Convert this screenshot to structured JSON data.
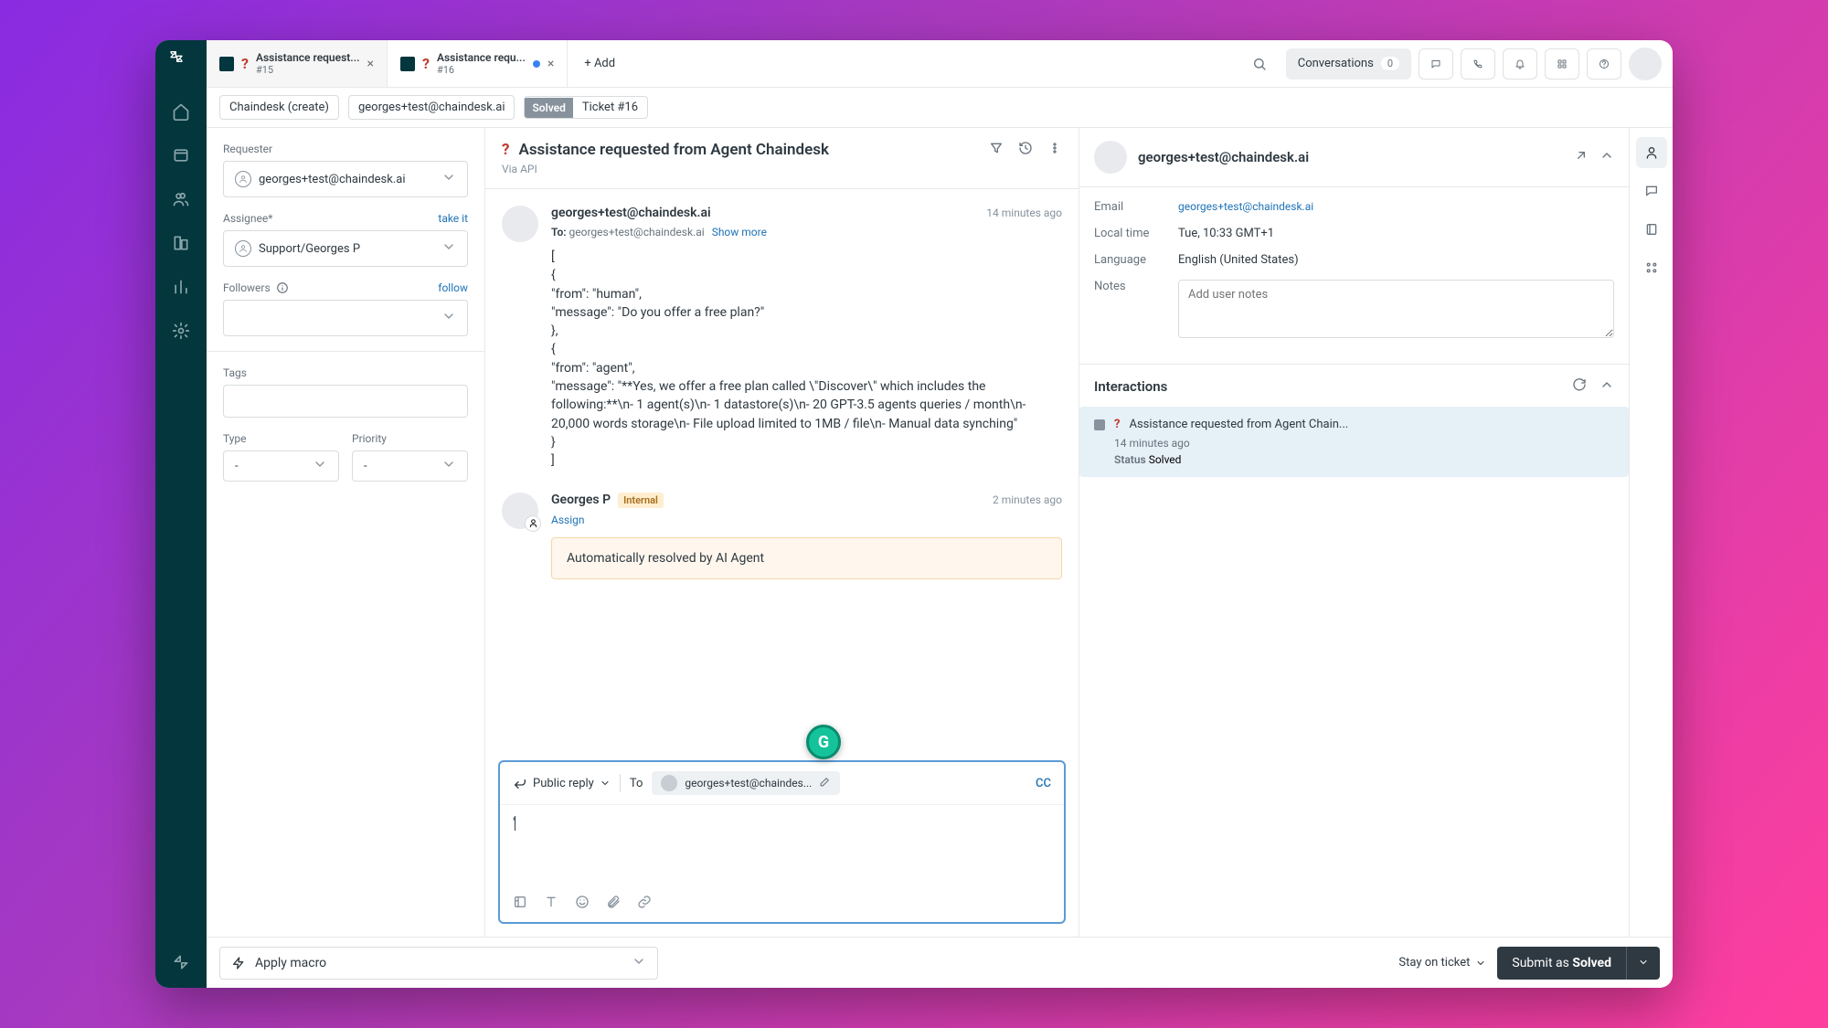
{
  "tabs": [
    {
      "title": "Assistance request...",
      "num": "#15"
    },
    {
      "title": "Assistance requ...",
      "num": "#16"
    }
  ],
  "addTab": "Add",
  "conversations": {
    "label": "Conversations",
    "count": "0"
  },
  "crumbs": {
    "org": "Chaindesk (create)",
    "email": "georges+test@chaindesk.ai",
    "status": "Solved",
    "ticket": "Ticket #16"
  },
  "left": {
    "requester": {
      "label": "Requester",
      "value": "georges+test@chaindesk.ai"
    },
    "assignee": {
      "label": "Assignee*",
      "link": "take it",
      "value": "Support/Georges P"
    },
    "followers": {
      "label": "Followers",
      "link": "follow"
    },
    "tags": {
      "label": "Tags"
    },
    "type": {
      "label": "Type",
      "value": "-"
    },
    "priority": {
      "label": "Priority",
      "value": "-"
    }
  },
  "center": {
    "title": "Assistance requested from Agent Chaindesk",
    "via": "Via API",
    "msg1": {
      "from": "georges+test@chaindesk.ai",
      "time": "14 minutes ago",
      "to": "To:",
      "toval": "georges+test@chaindesk.ai",
      "showmore": "Show more",
      "body": "[\n{\n\"from\": \"human\",\n\"message\": \"Do you offer a free plan?\"\n},\n{\n\"from\": \"agent\",\n\"message\": \"**Yes, we offer a free plan called \\\"Discover\\\" which includes the following:**\\n- 1 agent(s)\\n- 1 datastore(s)\\n- 20 GPT-3.5 agents queries / month\\n- 20,000 words storage\\n- File upload limited to 1MB / file\\n- Manual data synching\"\n}\n]"
    },
    "msg2": {
      "from": "Georges P",
      "badge": "Internal",
      "time": "2 minutes ago",
      "assign": "Assign",
      "note": "Automatically resolved by AI Agent"
    },
    "composer": {
      "replytype": "Public reply",
      "to": "To",
      "chip": "georges+test@chaindes...",
      "cc": "CC"
    }
  },
  "footer": {
    "macro": "Apply macro",
    "stay": "Stay on ticket",
    "submit": "Submit as ",
    "submitStatus": "Solved"
  },
  "right": {
    "name": "georges+test@chaindesk.ai",
    "email": {
      "k": "Email",
      "v": "georges+test@chaindesk.ai"
    },
    "localtime": {
      "k": "Local time",
      "v": "Tue, 10:33 GMT+1"
    },
    "language": {
      "k": "Language",
      "v": "English (United States)"
    },
    "notes": {
      "k": "Notes",
      "ph": "Add user notes"
    },
    "interactions": {
      "title": "Interactions",
      "item": {
        "title": "Assistance requested from Agent Chain...",
        "time": "14 minutes ago",
        "statuslbl": "Status",
        "status": "Solved"
      }
    }
  }
}
